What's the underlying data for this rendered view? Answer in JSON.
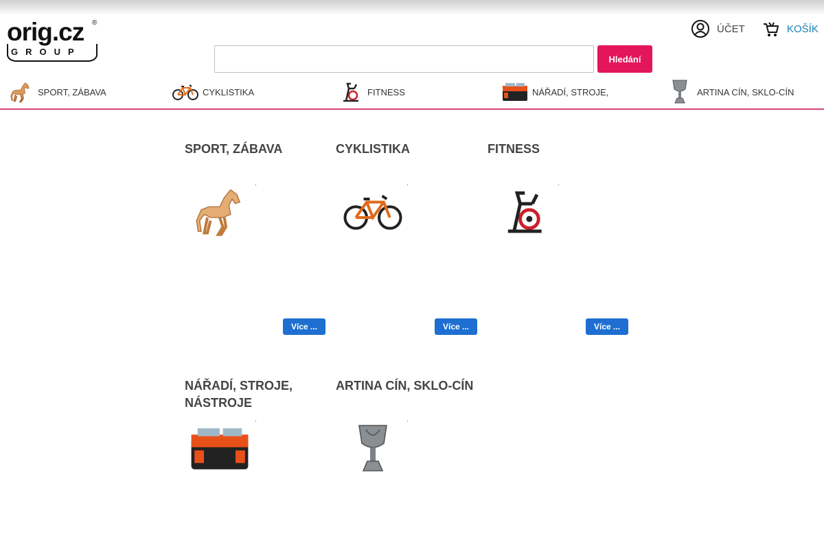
{
  "logo": {
    "brand": "orig.cz",
    "sub": "GROUP",
    "reg": "®"
  },
  "header": {
    "account_label": "ÚČET",
    "cart_label": "KOŠÍK"
  },
  "search": {
    "value": "",
    "placeholder": "",
    "button_label": "Hledání"
  },
  "nav": {
    "items": [
      {
        "label": "SPORT, ZÁBAVA",
        "icon": "horse-icon"
      },
      {
        "label": "CYKLISTIKA",
        "icon": "bicycle-icon"
      },
      {
        "label": "FITNESS",
        "icon": "exercise-bike-icon"
      },
      {
        "label": "NÁŘADÍ, STROJE,",
        "icon": "toolbox-icon"
      },
      {
        "label": "ARTINA CÍN, SKLO-CÍN",
        "icon": "goblet-icon"
      }
    ]
  },
  "categories": [
    {
      "title": "SPORT, ZÁBAVA",
      "dot": ".",
      "more": "Více ...",
      "image": "horse-icon"
    },
    {
      "title": "CYKLISTIKA",
      "dot": ".",
      "more": "Více ...",
      "image": "bicycle-icon"
    },
    {
      "title": "FITNESS",
      "dot": ".",
      "more": "Více ...",
      "image": "exercise-bike-icon"
    },
    {
      "title_line1": "NÁŘADÍ, STROJE,",
      "title_line2": "NÁSTROJE",
      "dot": ".",
      "image": "toolbox-icon"
    },
    {
      "title": "ARTINA CÍN, SKLO-CÍN",
      "dot": ".",
      "image": "goblet-icon"
    }
  ],
  "colors": {
    "search_button": "#e3165b",
    "more_button": "#1e6fd1",
    "nav_underline": "#d7436e",
    "cart_link": "#1a7fb5"
  }
}
